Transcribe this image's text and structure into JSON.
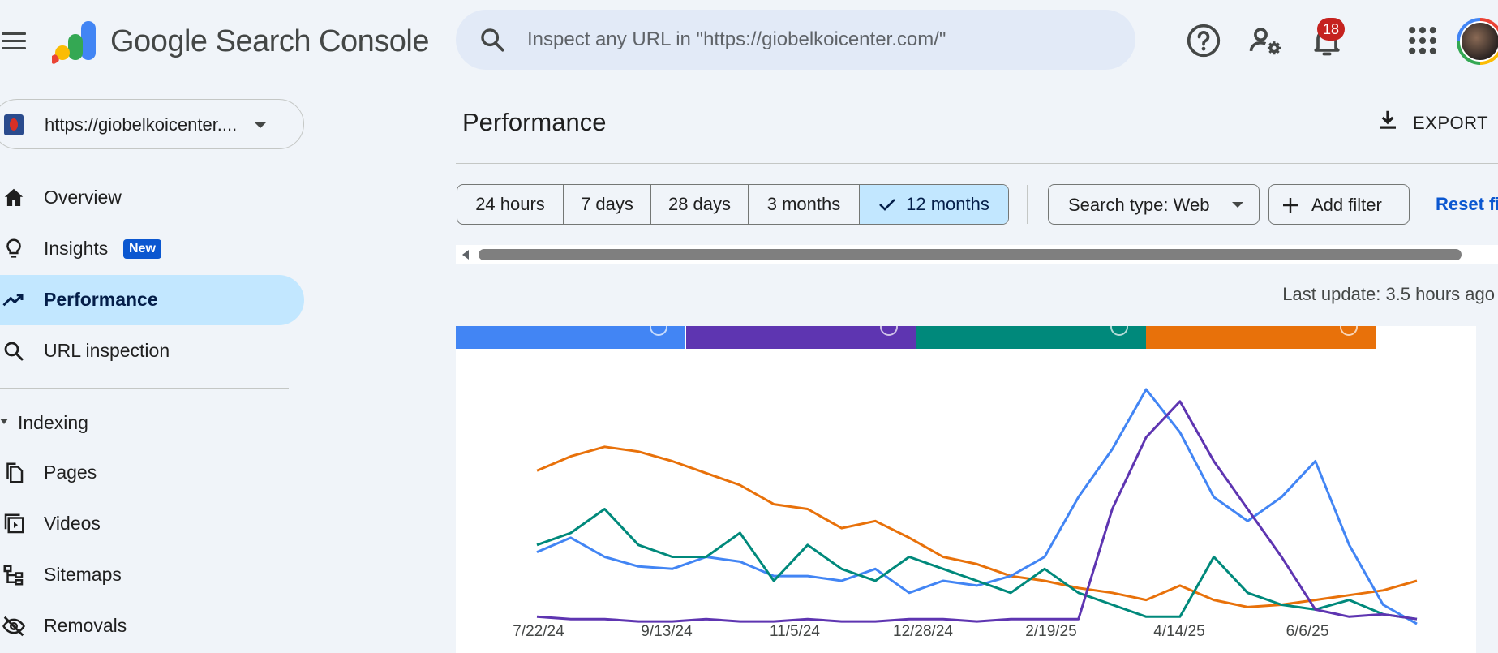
{
  "header": {
    "brand": "Google Search Console",
    "search_placeholder": "Inspect any URL in \"https://giobelkoicenter.com/\"",
    "notifications_count": "18",
    "icons": [
      "menu-icon",
      "help-icon",
      "manage-users-icon",
      "bell-icon",
      "apps-icon"
    ]
  },
  "sidebar": {
    "property_label": "https://giobelkoicenter....",
    "items": [
      {
        "label": "Overview",
        "icon": "home-icon"
      },
      {
        "label": "Insights",
        "icon": "lightbulb-icon",
        "badge": "New"
      },
      {
        "label": "Performance",
        "icon": "trending-up-icon",
        "active": true
      },
      {
        "label": "URL inspection",
        "icon": "search-icon"
      }
    ],
    "section_label": "Indexing",
    "section_items": [
      {
        "label": "Pages",
        "icon": "pages-icon"
      },
      {
        "label": "Videos",
        "icon": "video-icon"
      },
      {
        "label": "Sitemaps",
        "icon": "sitemap-icon"
      },
      {
        "label": "Removals",
        "icon": "eye-off-icon"
      }
    ]
  },
  "main": {
    "title": "Performance",
    "export_label": "EXPORT",
    "date_ranges": [
      "24 hours",
      "7 days",
      "28 days",
      "3 months",
      "12 months"
    ],
    "selected_range": "12 months",
    "search_type_label": "Search type: Web",
    "add_filter_label": "Add filter",
    "reset_label": "Reset fi",
    "last_update": "Last update: 3.5 hours ago"
  },
  "metric_tabs": [
    {
      "color": "#4285f4"
    },
    {
      "color": "#5e35b1"
    },
    {
      "color": "#00897b"
    },
    {
      "color": "#e8710a"
    }
  ],
  "chart_data": {
    "type": "line",
    "x_tick_labels": [
      "7/22/24",
      "9/13/24",
      "11/5/24",
      "12/28/24",
      "2/19/25",
      "4/14/25",
      "6/6/25"
    ],
    "y_scale": "each series normalised 0-1 (no y-axis labels shown)",
    "series": [
      {
        "color": "#e8710a",
        "values": [
          0.66,
          0.72,
          0.76,
          0.74,
          0.7,
          0.65,
          0.6,
          0.52,
          0.5,
          0.42,
          0.45,
          0.38,
          0.3,
          0.27,
          0.22,
          0.2,
          0.17,
          0.15,
          0.12,
          0.18,
          0.12,
          0.09,
          0.1,
          0.12,
          0.14,
          0.16,
          0.2
        ]
      },
      {
        "color": "#4285f4",
        "values": [
          0.32,
          0.38,
          0.3,
          0.26,
          0.25,
          0.3,
          0.28,
          0.22,
          0.22,
          0.2,
          0.25,
          0.15,
          0.2,
          0.18,
          0.22,
          0.3,
          0.55,
          0.75,
          1.0,
          0.82,
          0.55,
          0.45,
          0.55,
          0.7,
          0.35,
          0.1,
          0.02
        ]
      },
      {
        "color": "#00897b",
        "values": [
          0.35,
          0.4,
          0.5,
          0.35,
          0.3,
          0.3,
          0.4,
          0.2,
          0.35,
          0.25,
          0.2,
          0.3,
          0.25,
          0.2,
          0.15,
          0.25,
          0.15,
          0.1,
          0.05,
          0.05,
          0.3,
          0.15,
          0.1,
          0.08,
          0.12,
          0.06,
          0.04
        ]
      },
      {
        "color": "#5e35b1",
        "values": [
          0.05,
          0.04,
          0.04,
          0.03,
          0.03,
          0.04,
          0.03,
          0.03,
          0.04,
          0.03,
          0.03,
          0.04,
          0.04,
          0.03,
          0.04,
          0.04,
          0.04,
          0.5,
          0.8,
          0.95,
          0.7,
          0.5,
          0.3,
          0.08,
          0.05,
          0.06,
          0.04
        ]
      }
    ]
  }
}
